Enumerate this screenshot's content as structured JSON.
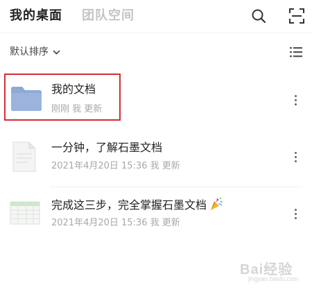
{
  "header": {
    "tabs": [
      {
        "label": "我的桌面",
        "active": true
      },
      {
        "label": "团队空间",
        "active": false
      }
    ],
    "icons": [
      "search-icon",
      "scan-icon"
    ]
  },
  "sortbar": {
    "sort_label": "默认排序",
    "icons": [
      "chevron-down-icon",
      "list-view-icon"
    ]
  },
  "files": [
    {
      "type": "folder",
      "title": "我的文档",
      "meta": "刚刚 我 更新",
      "icon": "folder-icon"
    },
    {
      "type": "doc",
      "title": "一分钟，了解石墨文档",
      "meta": "2021年4月20日 15:36 我 更新",
      "icon": "document-icon"
    },
    {
      "type": "sheet",
      "title": "完成这三步，完全掌握石墨文档",
      "meta": "2021年4月20日 15:36 我 更新",
      "icon": "spreadsheet-icon",
      "emoji": "party-popper-icon"
    }
  ],
  "colors": {
    "accent_highlight": "#d62b36",
    "folder": "#8fa9d6",
    "inactive_tab": "#c4c4c4",
    "meta_text": "#a8a8a8"
  },
  "watermark": {
    "text": "Bai经验",
    "sub": "jingyan.baidu.com"
  }
}
